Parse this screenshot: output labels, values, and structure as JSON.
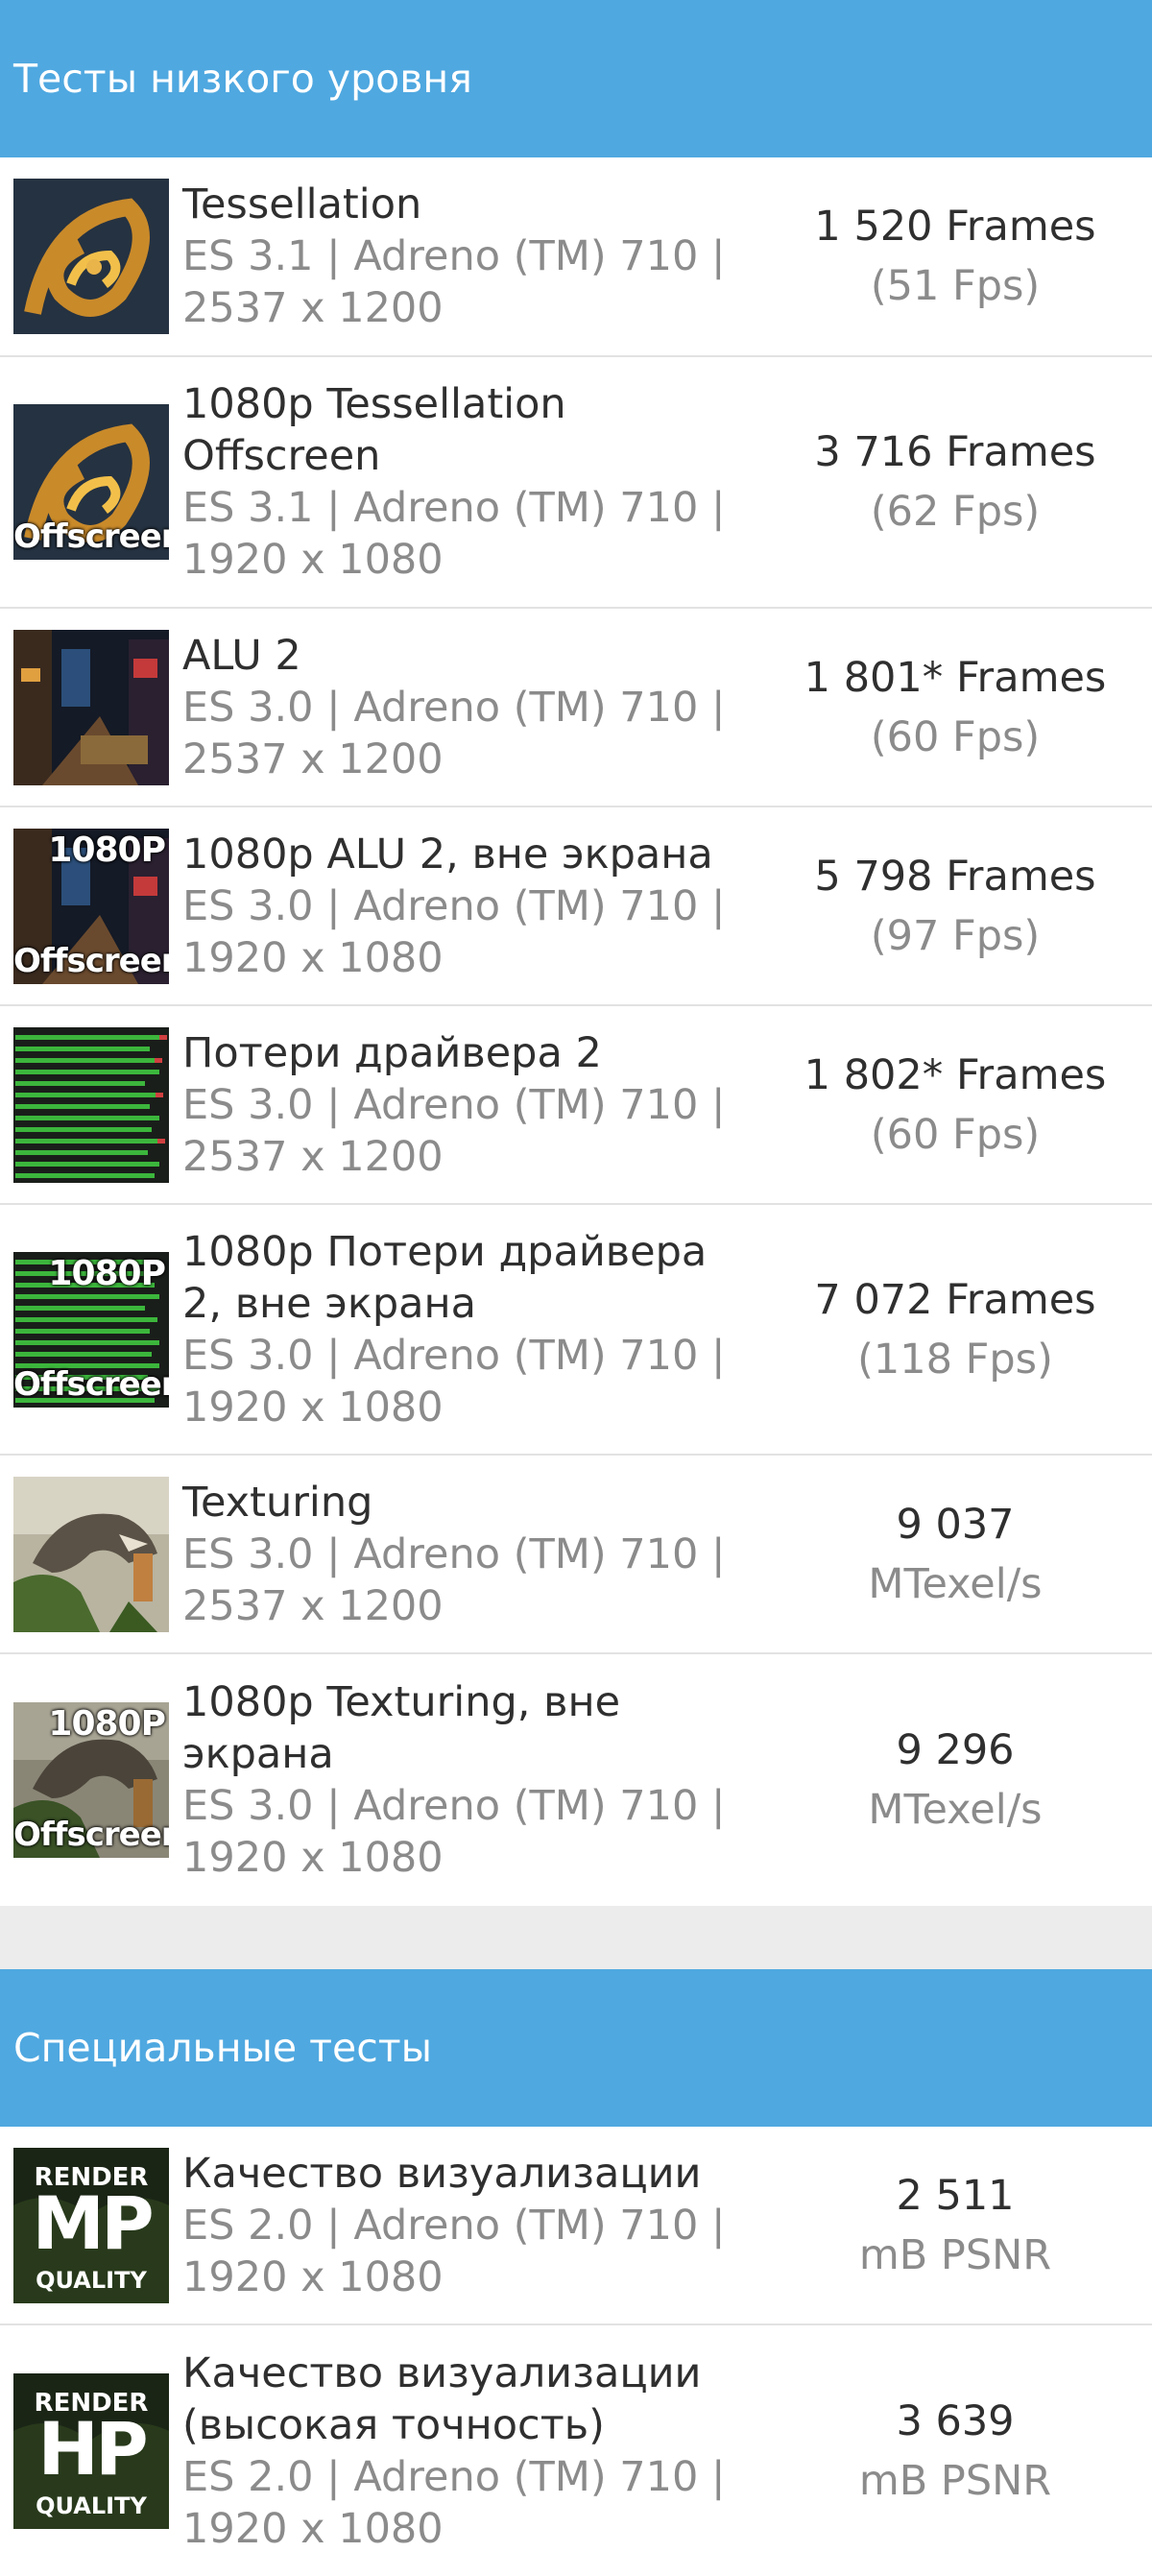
{
  "sections": [
    {
      "title": "Тесты низкого уровня",
      "items": [
        {
          "title": "Tessellation",
          "details": "ES 3.1 | Adreno (TM) 710 | 2537 x 1200",
          "result_main": "1 520 Frames",
          "result_sub": "(51 Fps)",
          "thumb": "tessellation-thumbnail"
        },
        {
          "title": "1080p Tessellation Offscreen",
          "details": "ES 3.1 | Adreno (TM) 710 | 1920 x 1080",
          "result_main": "3 716 Frames",
          "result_sub": "(62 Fps)",
          "thumb": "tessellation-offscreen-thumbnail",
          "overlay_bottom": "Offscreen"
        },
        {
          "title": "ALU 2",
          "details": "ES 3.0 | Adreno (TM) 710 | 2537 x 1200",
          "result_main": "1 801* Frames",
          "result_sub": "(60 Fps)",
          "thumb": "alu2-thumbnail"
        },
        {
          "title": "1080p ALU 2, вне экрана",
          "details": "ES 3.0 | Adreno (TM) 710 | 1920 x 1080",
          "result_main": "5 798 Frames",
          "result_sub": "(97 Fps)",
          "thumb": "alu2-offscreen-thumbnail",
          "overlay_top": "1080P",
          "overlay_bottom": "Offscreen"
        },
        {
          "title": "Потери драйвера 2",
          "details": "ES 3.0 | Adreno (TM) 710 | 2537 x 1200",
          "result_main": "1 802* Frames",
          "result_sub": "(60 Fps)",
          "thumb": "driver-overhead-thumbnail"
        },
        {
          "title": "1080p Потери драйвера 2, вне экрана",
          "details": "ES 3.0 | Adreno (TM) 710 | 1920 x 1080",
          "result_main": "7 072 Frames",
          "result_sub": "(118 Fps)",
          "thumb": "driver-overhead-offscreen-thumbnail",
          "overlay_top": "1080P",
          "overlay_bottom": "Offscreen"
        },
        {
          "title": "Texturing",
          "details": "ES 3.0 | Adreno (TM) 710 | 2537 x 1200",
          "result_main": "9 037",
          "result_sub": "MTexel/s",
          "thumb": "texturing-thumbnail"
        },
        {
          "title": "1080p Texturing, вне экрана",
          "details": "ES 3.0 | Adreno (TM) 710 | 1920 x 1080",
          "result_main": "9 296",
          "result_sub": "MTexel/s",
          "thumb": "texturing-offscreen-thumbnail",
          "overlay_top": "1080P",
          "overlay_bottom": "Offscreen"
        }
      ]
    },
    {
      "title": "Специальные тесты",
      "items": [
        {
          "title": "Качество визуализации",
          "details": "ES 2.0 | Adreno (TM) 710 | 1920 x 1080",
          "result_main": "2 511",
          "result_sub": "mB PSNR",
          "thumb": "render-quality-mp-thumbnail",
          "rq_top": "RENDER",
          "rq_mid": "MP",
          "rq_bottom": "QUALITY"
        },
        {
          "title": "Качество визуализации (высокая точность)",
          "details": "ES 2.0 | Adreno (TM) 710 | 1920 x 1080",
          "result_main": "3 639",
          "result_sub": "mB PSNR",
          "thumb": "render-quality-hp-thumbnail",
          "rq_top": "RENDER",
          "rq_mid": "HP",
          "rq_bottom": "QUALITY"
        }
      ]
    }
  ]
}
